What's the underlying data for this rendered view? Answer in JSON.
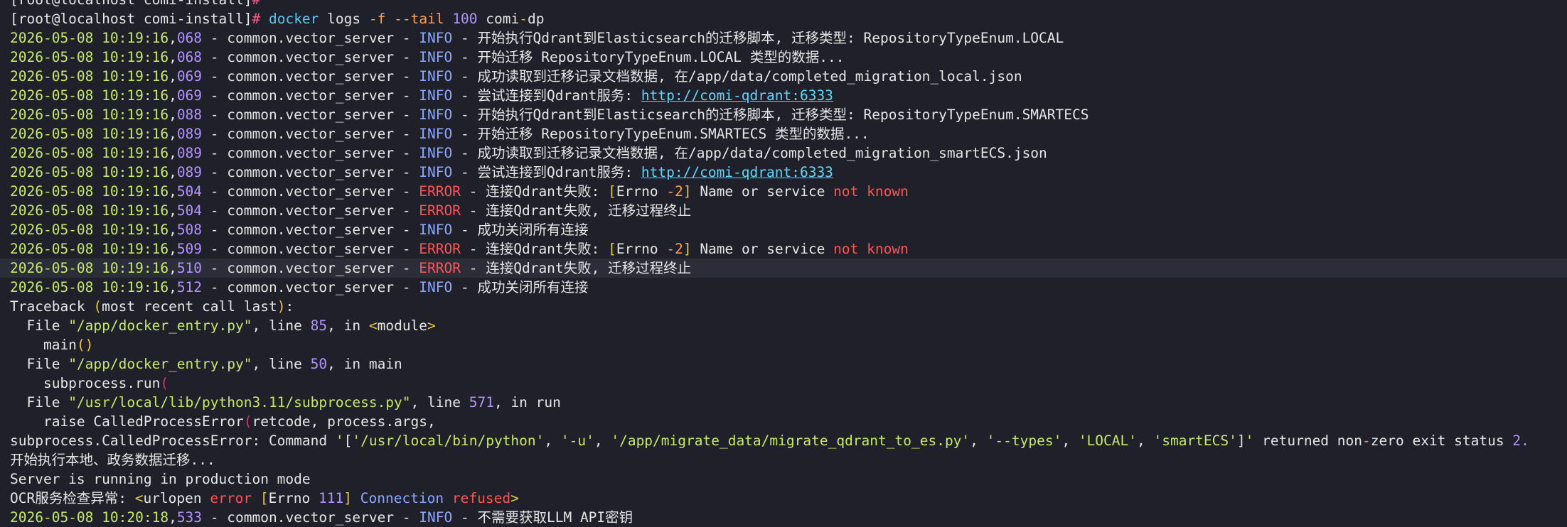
{
  "colors": {
    "background": "#1f2029",
    "highlight": "#2b2d38",
    "text": "#e6e6e6",
    "prompt_hash": "#ff5c8a",
    "command": "#5fc7f5",
    "flag": "#ffa04d",
    "number": "#b294ff",
    "timestamp": "#c8e86a",
    "info": "#8aa8ff",
    "error": "#ff5555",
    "link": "#5fd7ff",
    "string": "#c8e86a",
    "bracket": "#e8c84a",
    "paren_open": "#cc3b66"
  },
  "lines": [
    {
      "segs": [
        {
          "t": "[root@localhost comi-install]"
        },
        {
          "t": "#",
          "c": "prompt_hash"
        }
      ]
    },
    {
      "segs": [
        {
          "t": "[root@localhost comi-install]"
        },
        {
          "t": "#",
          "c": "prompt_hash"
        },
        {
          "t": " "
        },
        {
          "t": "docker",
          "c": "command"
        },
        {
          "t": " logs "
        },
        {
          "t": "-f",
          "c": "flag"
        },
        {
          "t": " "
        },
        {
          "t": "--tail",
          "c": "flag"
        },
        {
          "t": " "
        },
        {
          "t": "100",
          "c": "number"
        },
        {
          "t": " comi"
        },
        {
          "t": "-",
          "c": "flag"
        },
        {
          "t": "dp"
        }
      ]
    },
    {
      "segs": [
        {
          "t": "2026-05-08 10:19:16",
          "c": "timestamp"
        },
        {
          "t": ",",
          "c": "text"
        },
        {
          "t": "068",
          "c": "number"
        },
        {
          "t": " - common.vector_server - "
        },
        {
          "t": "INFO",
          "c": "info"
        },
        {
          "t": " - 开始执行Qdrant到Elasticsearch的迁移脚本, 迁移类型: RepositoryTypeEnum.LOCAL"
        }
      ]
    },
    {
      "segs": [
        {
          "t": "2026-05-08 10:19:16",
          "c": "timestamp"
        },
        {
          "t": ","
        },
        {
          "t": "068",
          "c": "number"
        },
        {
          "t": " - common.vector_server - "
        },
        {
          "t": "INFO",
          "c": "info"
        },
        {
          "t": " - 开始迁移 RepositoryTypeEnum.LOCAL 类型的数据..."
        }
      ]
    },
    {
      "segs": [
        {
          "t": "2026-05-08 10:19:16",
          "c": "timestamp"
        },
        {
          "t": ","
        },
        {
          "t": "069",
          "c": "number"
        },
        {
          "t": " - common.vector_server - "
        },
        {
          "t": "INFO",
          "c": "info"
        },
        {
          "t": " - 成功读取到迁移记录文档数据, 在/app/data/completed_migration_local.json"
        }
      ]
    },
    {
      "segs": [
        {
          "t": "2026-05-08 10:19:16",
          "c": "timestamp"
        },
        {
          "t": ","
        },
        {
          "t": "069",
          "c": "number"
        },
        {
          "t": " - common.vector_server - "
        },
        {
          "t": "INFO",
          "c": "info"
        },
        {
          "t": " - 尝试连接到Qdrant服务: "
        },
        {
          "t": "http://comi-qdrant:6333",
          "c": "link",
          "u": true
        }
      ]
    },
    {
      "segs": [
        {
          "t": "2026-05-08 10:19:16",
          "c": "timestamp"
        },
        {
          "t": ","
        },
        {
          "t": "088",
          "c": "number"
        },
        {
          "t": " - common.vector_server - "
        },
        {
          "t": "INFO",
          "c": "info"
        },
        {
          "t": " - 开始执行Qdrant到Elasticsearch的迁移脚本, 迁移类型: RepositoryTypeEnum.SMARTECS"
        }
      ]
    },
    {
      "segs": [
        {
          "t": "2026-05-08 10:19:16",
          "c": "timestamp"
        },
        {
          "t": ","
        },
        {
          "t": "089",
          "c": "number"
        },
        {
          "t": " - common.vector_server - "
        },
        {
          "t": "INFO",
          "c": "info"
        },
        {
          "t": " - 开始迁移 RepositoryTypeEnum.SMARTECS 类型的数据..."
        }
      ]
    },
    {
      "segs": [
        {
          "t": "2026-05-08 10:19:16",
          "c": "timestamp"
        },
        {
          "t": ","
        },
        {
          "t": "089",
          "c": "number"
        },
        {
          "t": " - common.vector_server - "
        },
        {
          "t": "INFO",
          "c": "info"
        },
        {
          "t": " - 成功读取到迁移记录文档数据, 在/app/data/completed_migration_smartECS.json"
        }
      ]
    },
    {
      "segs": [
        {
          "t": "2026-05-08 10:19:16",
          "c": "timestamp"
        },
        {
          "t": ","
        },
        {
          "t": "089",
          "c": "number"
        },
        {
          "t": " - common.vector_server - "
        },
        {
          "t": "INFO",
          "c": "info"
        },
        {
          "t": " - 尝试连接到Qdrant服务: "
        },
        {
          "t": "http://comi-qdrant:6333",
          "c": "link",
          "u": true
        }
      ]
    },
    {
      "segs": [
        {
          "t": "2026-05-08 10:19:16",
          "c": "timestamp"
        },
        {
          "t": ","
        },
        {
          "t": "504",
          "c": "number"
        },
        {
          "t": " - common.vector_server - "
        },
        {
          "t": "ERROR",
          "c": "error"
        },
        {
          "t": " - 连接Qdrant失败: "
        },
        {
          "t": "[",
          "c": "bracket"
        },
        {
          "t": "Errno "
        },
        {
          "t": "-2",
          "c": "flag"
        },
        {
          "t": "]",
          "c": "bracket"
        },
        {
          "t": " Name or service "
        },
        {
          "t": "not known",
          "c": "error"
        }
      ]
    },
    {
      "segs": [
        {
          "t": "2026-05-08 10:19:16",
          "c": "timestamp"
        },
        {
          "t": ","
        },
        {
          "t": "504",
          "c": "number"
        },
        {
          "t": " - common.vector_server - "
        },
        {
          "t": "ERROR",
          "c": "error"
        },
        {
          "t": " - 连接Qdrant失败, 迁移过程终止"
        }
      ]
    },
    {
      "segs": [
        {
          "t": "2026-05-08 10:19:16",
          "c": "timestamp"
        },
        {
          "t": ","
        },
        {
          "t": "508",
          "c": "number"
        },
        {
          "t": " - common.vector_server - "
        },
        {
          "t": "INFO",
          "c": "info"
        },
        {
          "t": " - 成功关闭所有连接"
        }
      ]
    },
    {
      "segs": [
        {
          "t": "2026-05-08 10:19:16",
          "c": "timestamp"
        },
        {
          "t": ","
        },
        {
          "t": "509",
          "c": "number"
        },
        {
          "t": " - common.vector_server - "
        },
        {
          "t": "ERROR",
          "c": "error"
        },
        {
          "t": " - 连接Qdrant失败: "
        },
        {
          "t": "[",
          "c": "bracket"
        },
        {
          "t": "Errno "
        },
        {
          "t": "-2",
          "c": "flag"
        },
        {
          "t": "]",
          "c": "bracket"
        },
        {
          "t": " Name or service "
        },
        {
          "t": "not known",
          "c": "error"
        }
      ]
    },
    {
      "hl": true,
      "segs": [
        {
          "t": "2026-05-08 10:19:16",
          "c": "timestamp"
        },
        {
          "t": ","
        },
        {
          "t": "510",
          "c": "number"
        },
        {
          "t": " - common.vector_server - "
        },
        {
          "t": "ERROR",
          "c": "error"
        },
        {
          "t": " - 连接Qdrant失败, 迁移过程终止"
        }
      ]
    },
    {
      "segs": [
        {
          "t": "2026-05-08 10:19:16",
          "c": "timestamp"
        },
        {
          "t": ","
        },
        {
          "t": "512",
          "c": "number"
        },
        {
          "t": " - common.vector_server - "
        },
        {
          "t": "INFO",
          "c": "info"
        },
        {
          "t": " - 成功关闭所有连接"
        }
      ]
    },
    {
      "segs": [
        {
          "t": "Traceback "
        },
        {
          "t": "(",
          "c": "bracket"
        },
        {
          "t": "most recent call last"
        },
        {
          "t": ")",
          "c": "bracket"
        },
        {
          "t": ":"
        }
      ]
    },
    {
      "segs": [
        {
          "t": "  File "
        },
        {
          "t": "\"/app/docker_entry.py\"",
          "c": "string"
        },
        {
          "t": ", line "
        },
        {
          "t": "85",
          "c": "number"
        },
        {
          "t": ", in "
        },
        {
          "t": "<",
          "c": "bracket"
        },
        {
          "t": "module"
        },
        {
          "t": ">",
          "c": "bracket"
        }
      ]
    },
    {
      "segs": [
        {
          "t": "    main"
        },
        {
          "t": "()",
          "c": "bracket"
        }
      ]
    },
    {
      "segs": [
        {
          "t": "  File "
        },
        {
          "t": "\"/app/docker_entry.py\"",
          "c": "string"
        },
        {
          "t": ", line "
        },
        {
          "t": "50",
          "c": "number"
        },
        {
          "t": ", in main"
        }
      ]
    },
    {
      "segs": [
        {
          "t": "    subprocess.run"
        },
        {
          "t": "(",
          "c": "paren_open"
        }
      ]
    },
    {
      "segs": [
        {
          "t": "  File "
        },
        {
          "t": "\"/usr/local/lib/python3.11/subprocess.py\"",
          "c": "string"
        },
        {
          "t": ", line "
        },
        {
          "t": "571",
          "c": "number"
        },
        {
          "t": ", in run"
        }
      ]
    },
    {
      "segs": [
        {
          "t": "    raise CalledProcessError"
        },
        {
          "t": "(",
          "c": "paren_open"
        },
        {
          "t": "retcode, process.args,"
        }
      ]
    },
    {
      "segs": [
        {
          "t": "subprocess.CalledProcessError: Command "
        },
        {
          "t": "'",
          "c": "string"
        },
        {
          "t": "["
        },
        {
          "t": "'/usr/local/bin/python'",
          "c": "string"
        },
        {
          "t": ", "
        },
        {
          "t": "'-u'",
          "c": "string"
        },
        {
          "t": ", "
        },
        {
          "t": "'/app/migrate_data/migrate_qdrant_to_es.py'",
          "c": "string"
        },
        {
          "t": ", "
        },
        {
          "t": "'--types'",
          "c": "string"
        },
        {
          "t": ", "
        },
        {
          "t": "'LOCAL'",
          "c": "string"
        },
        {
          "t": ", "
        },
        {
          "t": "'smartECS'",
          "c": "string"
        },
        {
          "t": "]"
        },
        {
          "t": "'",
          "c": "string"
        },
        {
          "t": " returned non"
        },
        {
          "t": "-",
          "c": "flag"
        },
        {
          "t": "zero exit status "
        },
        {
          "t": "2.",
          "c": "number"
        }
      ]
    },
    {
      "segs": [
        {
          "t": "开始执行本地、政务数据迁移..."
        }
      ]
    },
    {
      "segs": [
        {
          "t": "Server is running in production mode"
        }
      ]
    },
    {
      "segs": [
        {
          "t": "OCR服务检查异常: "
        },
        {
          "t": "<",
          "c": "bracket"
        },
        {
          "t": "urlopen "
        },
        {
          "t": "error",
          "c": "error"
        },
        {
          "t": " "
        },
        {
          "t": "[",
          "c": "bracket"
        },
        {
          "t": "Errno "
        },
        {
          "t": "111",
          "c": "number"
        },
        {
          "t": "]",
          "c": "bracket"
        },
        {
          "t": " "
        },
        {
          "t": "Connection",
          "c": "info"
        },
        {
          "t": " "
        },
        {
          "t": "refused",
          "c": "error"
        },
        {
          "t": ">",
          "c": "bracket"
        }
      ]
    },
    {
      "segs": [
        {
          "t": "2026-05-08 10:20:18",
          "c": "timestamp"
        },
        {
          "t": ","
        },
        {
          "t": "533",
          "c": "number"
        },
        {
          "t": " - common.vector_server - "
        },
        {
          "t": "INFO",
          "c": "info"
        },
        {
          "t": " - 不需要获取LLM API密钥"
        }
      ]
    }
  ]
}
